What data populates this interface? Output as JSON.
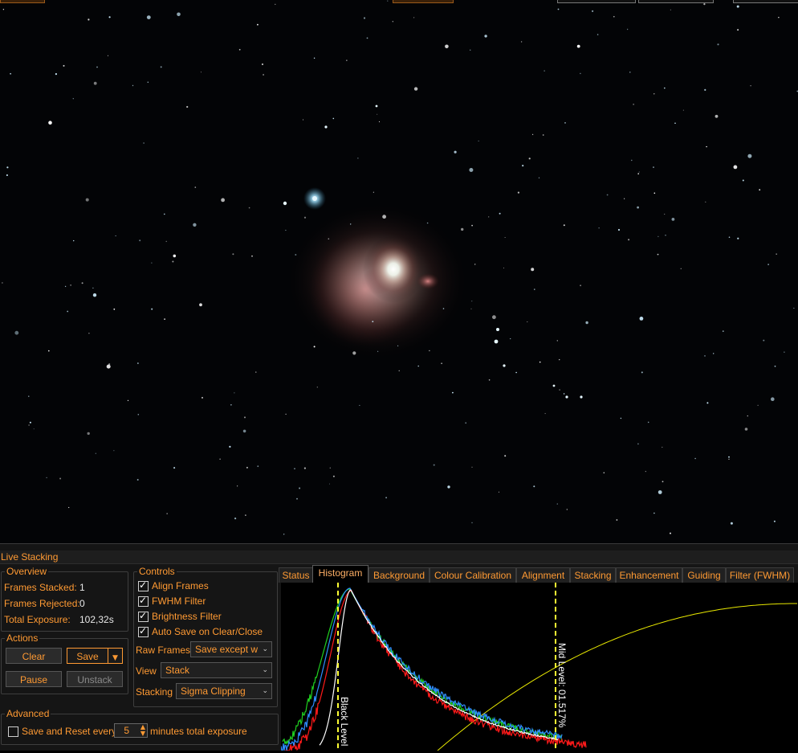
{
  "panel": {
    "title": "Live Stacking"
  },
  "overview": {
    "label": "Overview",
    "frames_stacked_label": "Frames Stacked:",
    "frames_stacked": "1",
    "frames_rejected_label": "Frames Rejected:",
    "frames_rejected": "0",
    "total_exposure_label": "Total Exposure:",
    "total_exposure": "102,32s"
  },
  "actions": {
    "label": "Actions",
    "clear": "Clear",
    "save": "Save",
    "pause": "Pause",
    "unstack": "Unstack"
  },
  "controls": {
    "label": "Controls",
    "align_frames": "Align Frames",
    "fwhm_filter": "FWHM Filter",
    "brightness_filter": "Brightness Filter",
    "auto_save": "Auto Save on Clear/Close",
    "raw_frames_label": "Raw Frames",
    "raw_frames_value": "Save except w",
    "view_label": "View",
    "view_value": "Stack",
    "stacking_label": "Stacking",
    "stacking_value": "Sigma Clipping"
  },
  "advanced": {
    "label": "Advanced",
    "save_reset_label": "Save and Reset every",
    "minutes_value": "5",
    "suffix": "minutes total exposure"
  },
  "tabs": [
    "Status",
    "Histogram",
    "Background",
    "Colour Calibration",
    "Alignment",
    "Stacking",
    "Enhancement",
    "Guiding",
    "Filter (FWHM)"
  ],
  "active_tab": "Histogram",
  "histogram": {
    "black_level_label": "Black Level",
    "mid_level_label": "Mid Level: 01.517%",
    "colors": {
      "red": "#ff1a1a",
      "green": "#1fd01f",
      "blue": "#2f8cff",
      "luminance": "#ffffff",
      "curve": "#e8e800",
      "marker": "#ffff33"
    }
  },
  "icons": {
    "dropdown": "chevron-down-icon",
    "spinner": "spinner-arrows-icon",
    "check": "checkmark-icon"
  }
}
